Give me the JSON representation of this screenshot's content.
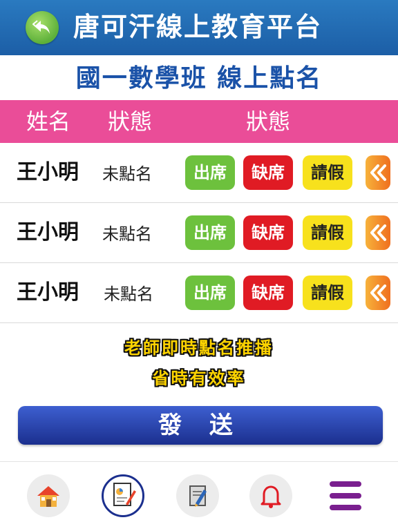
{
  "header": {
    "title": "唐可汗線上教育平台"
  },
  "subtitle": "國一數學班  線上點名",
  "columns": [
    "姓名",
    "狀態",
    "狀態"
  ],
  "rows": [
    {
      "name": "王小明",
      "status": "未點名"
    },
    {
      "name": "王小明",
      "status": "未點名"
    },
    {
      "name": "王小明",
      "status": "未點名"
    }
  ],
  "actions": {
    "present": "出席",
    "absent": "缺席",
    "leave": "請假"
  },
  "promo": {
    "line1": "老師即時點名推播",
    "line2": "省時有效率"
  },
  "send_label": "發 送",
  "colors": {
    "header_blue": "#1c5ea6",
    "pink": "#ea4d98",
    "present": "#6dc13d",
    "absent": "#e01b24",
    "leave": "#f7e11d",
    "send": "#2440a8",
    "menu_purple": "#7a1f8f"
  },
  "bottom_nav": [
    {
      "icon": "home-icon"
    },
    {
      "icon": "report-chart-icon"
    },
    {
      "icon": "edit-document-icon"
    },
    {
      "icon": "bell-icon"
    },
    {
      "icon": "menu-icon"
    }
  ]
}
